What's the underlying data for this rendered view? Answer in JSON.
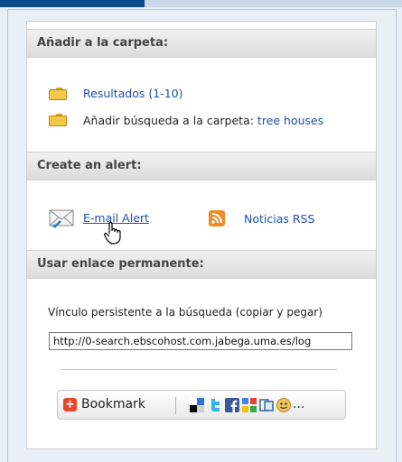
{
  "section_folder": {
    "title": "Añadir a la carpeta:",
    "results_link": "Resultados (1-10)",
    "add_search_label": "Añadir búsqueda a la carpeta: ",
    "add_search_link": "tree houses"
  },
  "section_alert": {
    "title": "Create an alert:",
    "email_alert": "E-mail Alert",
    "rss": "Noticias RSS"
  },
  "section_permalink": {
    "title": "Usar enlace permanente:",
    "label": "Vínculo persistente a la búsqueda (copiar y pegar)",
    "url": "http://0-search.ebscohost.com.jabega.uma.es/log"
  },
  "share": {
    "bookmark_label": "Bookmark",
    "more": "..."
  },
  "colors": {
    "link": "#1f4fb0",
    "header_bg": "#e0e0e0",
    "page_bg": "#e8eff6",
    "rss_orange": "#f08a24"
  },
  "icons": [
    "folder-icon",
    "envelope-icon",
    "rss-icon",
    "hand-cursor-icon",
    "bookmark-icon",
    "delicious-icon",
    "twitter-icon",
    "facebook-icon",
    "google-icon",
    "digg-icon",
    "smiley-icon"
  ]
}
